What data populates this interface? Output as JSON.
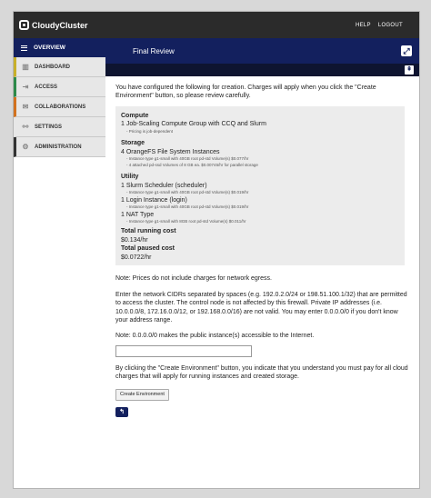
{
  "app": {
    "name": "CloudyCluster"
  },
  "topbar": {
    "help": "HELP",
    "logout": "LOGOUT"
  },
  "sidebar": {
    "overview": "OVERVIEW",
    "items": [
      {
        "label": "DASHBOARD",
        "icon": "bar-chart-icon"
      },
      {
        "label": "ACCESS",
        "icon": "login-icon"
      },
      {
        "label": "COLLABORATIONS",
        "icon": "mail-icon"
      },
      {
        "label": "SETTINGS",
        "icon": "link-icon"
      },
      {
        "label": "ADMINISTRATION",
        "icon": "admin-icon"
      }
    ]
  },
  "main": {
    "title": "Final Review",
    "intro": "You have configured the following for creation. Charges will apply when you click the \"Create Environment\" button, so please review carefully.",
    "summary": {
      "compute_head": "Compute",
      "compute_line": "1 Job-Scaling Compute Group with CCQ and Slurm",
      "compute_sub": "- Pricing is job-dependent",
      "storage_head": "Storage",
      "storage_line": "4 OrangeFS File System Instances",
      "storage_sub1": "- Instance type g1-small with 40GB root pd-std Volume(s) $0.077/hr",
      "storage_sub2": "- 4 attached pd-ssd Volumes of 8 GB ea. $0.00745/hr for parallel storage",
      "utility_head": "Utility",
      "utility_line1": "1 Slurm Scheduler (scheduler)",
      "utility_sub1": "- Instance type g1-small with 40GB root pd-std Volume(s) $0.019/hr",
      "utility_line2": "1 Login Instance (login)",
      "utility_sub2": "- Instance type g1-small with 40GB root pd-std Volume(s) $0.019/hr",
      "utility_line3": "1 NAT Type",
      "utility_sub3": "- Instance type g1-small with 8GB root pd-std Volume(s) $0.011/hr",
      "running_head": "Total running cost",
      "running_value": "$0.134/hr",
      "paused_head": "Total paused cost",
      "paused_value": "$0.0722/hr"
    },
    "note_egress": "Note: Prices do not include charges for network egress.",
    "cidr_text": "Enter the network CIDRs separated by spaces (e.g. 192.0.2.0/24 or 198.51.100.1/32) that are permitted to access the cluster. The control node is not affected by this firewall. Private IP addresses (i.e. 10.0.0.0/8, 172.16.0.0/12, or 192.168.0.0/16) are not valid. You may enter 0.0.0.0/0 if you don't know your address range.",
    "note_public": "Note: 0.0.0.0/0 makes the public instance(s) accessible to the Internet.",
    "cidr_value": "",
    "agree_text": "By clicking the \"Create Environment\" button, you indicate that you understand you must pay for all cloud charges that will apply for running instances and created storage.",
    "create_button": "Create Environment",
    "back_glyph": "↰"
  }
}
